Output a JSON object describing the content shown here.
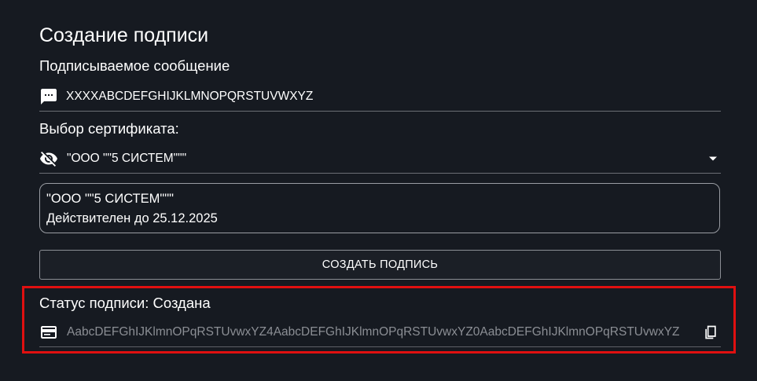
{
  "page": {
    "title": "Создание подписи"
  },
  "message": {
    "label": "Подписываемое сообщение",
    "value": "XXXXABCDEFGHIJKLMNOPQRSTUVWXYZ",
    "icon": "message-icon"
  },
  "certificate": {
    "label": "Выбор сертификата:",
    "selected": "\"ООО \"\"5 СИСТЕМ\"\"\"",
    "icon": "visibility-off-icon",
    "dropdown_icon": "chevron-down-icon",
    "card": {
      "name": "\"ООО \"\"5 СИСТЕМ\"\"\"",
      "validity": "Действителен до 25.12.2025"
    }
  },
  "actions": {
    "create_label": "СОЗДАТЬ ПОДПИСЬ"
  },
  "signature": {
    "status_label": "Статус подписи: Создана",
    "value": "AabcDEFGhIJKlmnOPqRSTUvwxYZ4AabcDEFGhIJKlmnOPqRSTUvwxYZ0AabcDEFGhIJKlmnOPqRSTUvwxYZ",
    "icon": "card-icon",
    "copy_icon": "copy-icon"
  },
  "colors": {
    "background": "#161a21",
    "highlight": "#e01010",
    "text": "#ffffff",
    "muted_text": "#8b8e94"
  }
}
